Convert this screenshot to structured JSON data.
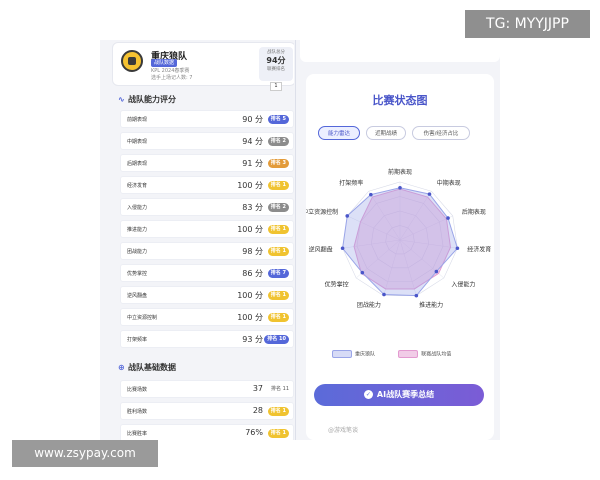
{
  "team": {
    "name": "重庆狼队",
    "tag": "战队数据",
    "season": "KPL 2024春季赛",
    "players": "选手上场记人数: 7",
    "score_label": "战队总分",
    "score": "94分",
    "rank_label": "联赛排名",
    "rank": "1"
  },
  "ability": {
    "title": "战队能力评分",
    "rows": [
      {
        "name": "前期表现",
        "value": "90 分",
        "rank": "排名 5",
        "color": "#5467d9"
      },
      {
        "name": "中期表现",
        "value": "94 分",
        "rank": "排名 2",
        "color": "#8c8c8c"
      },
      {
        "name": "后期表现",
        "value": "91 分",
        "rank": "排名 3",
        "color": "#e39b3a"
      },
      {
        "name": "经济发育",
        "value": "100 分",
        "rank": "排名 1",
        "color": "#f0c330"
      },
      {
        "name": "入侵能力",
        "value": "83 分",
        "rank": "排名 2",
        "color": "#8c8c8c"
      },
      {
        "name": "推进能力",
        "value": "100 分",
        "rank": "排名 1",
        "color": "#f0c330"
      },
      {
        "name": "团战能力",
        "value": "98 分",
        "rank": "排名 1",
        "color": "#f0c330"
      },
      {
        "name": "优势掌控",
        "value": "86 分",
        "rank": "排名 7",
        "color": "#5467d9"
      },
      {
        "name": "逆风翻盘",
        "value": "100 分",
        "rank": "排名 1",
        "color": "#f0c330"
      },
      {
        "name": "中立资源控制",
        "value": "100 分",
        "rank": "排名 1",
        "color": "#f0c330"
      },
      {
        "name": "打架频率",
        "value": "93 分",
        "rank": "排名 10",
        "color": "#5467d9"
      }
    ]
  },
  "basic": {
    "title": "战队基础数据",
    "rows": [
      {
        "name": "比赛场数",
        "value": "37",
        "rank": "排名 11"
      },
      {
        "name": "胜利场数",
        "value": "28",
        "rank": "排名 1"
      },
      {
        "name": "比赛胜率",
        "value": "76%",
        "rank": "排名 1"
      }
    ]
  },
  "status": {
    "title": "比赛状态图",
    "tabs": [
      "能力雷达",
      "近期战绩",
      "伤害/经济占比"
    ],
    "active_tab": 0,
    "axes": [
      "前期表现",
      "中期表现",
      "后期表现",
      "经济发育",
      "入侵能力",
      "推进能力",
      "团战能力",
      "优势掌控",
      "逆风翻盘",
      "中立资源控制",
      "打架频率"
    ],
    "legend_team": "重庆狼队",
    "legend_avg": "联赛战队均值",
    "team_color": "#9aa5e8",
    "avg_color": "#e39ad0",
    "ai_button": "AI战队赛季总结"
  },
  "chart_data": {
    "type": "radar",
    "categories": [
      "前期表现",
      "中期表现",
      "后期表现",
      "经济发育",
      "入侵能力",
      "推进能力",
      "团战能力",
      "优势掌控",
      "逆风翻盘",
      "中立资源控制",
      "打架频率"
    ],
    "series": [
      {
        "name": "重庆狼队",
        "values": [
          90,
          94,
          91,
          100,
          83,
          100,
          98,
          86,
          100,
          100,
          93
        ]
      },
      {
        "name": "联赛战队均值",
        "values": [
          88,
          88,
          88,
          88,
          88,
          88,
          88,
          88,
          80,
          75,
          88
        ]
      }
    ],
    "ylim": [
      0,
      100
    ]
  },
  "watermark": {
    "tg": "TG: MYYJJPP",
    "url": "www.zsypay.com",
    "weibo": "@游戏笔谈"
  }
}
